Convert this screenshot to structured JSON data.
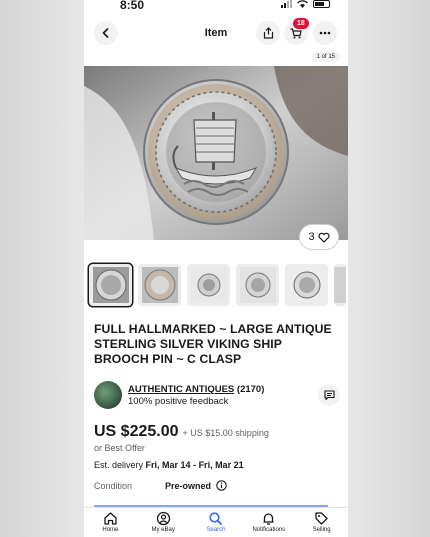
{
  "status_bar": {
    "time": "8:50"
  },
  "header": {
    "title": "Item",
    "cart_count": "18"
  },
  "gallery": {
    "photo_counter": "1 of 15",
    "like_count": "3",
    "thumbnail_count": 6
  },
  "listing": {
    "title": "FULL HALLMARKED ~ LARGE ANTIQUE STERLING SILVER VIKING SHIP BROOCH PIN ~ C CLASP"
  },
  "seller": {
    "name": "AUTHENTIC ANTIQUES",
    "rating_count": "(2170)",
    "feedback": "100% positive feedback"
  },
  "price": {
    "amount": "US $225.00",
    "shipping": "+ US $15.00 shipping",
    "best_offer": "or Best Offer"
  },
  "delivery": {
    "label": "Est. delivery",
    "dates": "Fri, Mar 14 - Fri, Mar 21"
  },
  "condition": {
    "label": "Condition",
    "value": "Pre-owned"
  },
  "tabbar": {
    "items": [
      {
        "label": "Home",
        "icon": "home-icon"
      },
      {
        "label": "My eBay",
        "icon": "user-icon"
      },
      {
        "label": "Search",
        "icon": "search-icon"
      },
      {
        "label": "Notifications",
        "icon": "bell-icon"
      },
      {
        "label": "Selling",
        "icon": "tag-icon"
      }
    ],
    "active": "Search"
  },
  "colors": {
    "accent": "#3665f3",
    "badge": "#e0103a",
    "text": "#191919"
  }
}
